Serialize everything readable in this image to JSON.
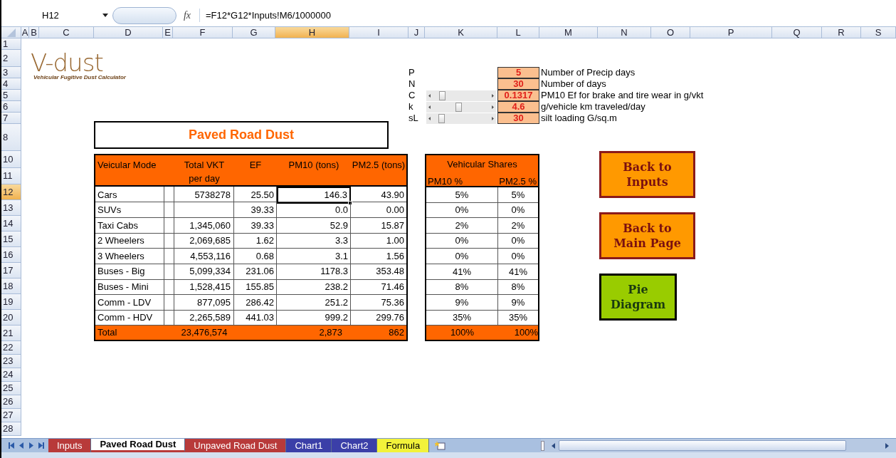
{
  "formula_bar": {
    "name_box": "H12",
    "function_button": "fx",
    "formula": "=F12*G12*Inputs!M6/1000000"
  },
  "columns": [
    {
      "label": "A",
      "selected": false
    },
    {
      "label": "B",
      "selected": false
    },
    {
      "label": "C",
      "selected": false
    },
    {
      "label": "D",
      "selected": false
    },
    {
      "label": "E",
      "selected": false
    },
    {
      "label": "F",
      "selected": false
    },
    {
      "label": "G",
      "selected": false
    },
    {
      "label": "H",
      "selected": true
    },
    {
      "label": "I",
      "selected": false
    },
    {
      "label": "J",
      "selected": false
    },
    {
      "label": "K",
      "selected": false
    },
    {
      "label": "L",
      "selected": false
    },
    {
      "label": "M",
      "selected": false
    },
    {
      "label": "N",
      "selected": false
    },
    {
      "label": "O",
      "selected": false
    },
    {
      "label": "P",
      "selected": false
    },
    {
      "label": "Q",
      "selected": false
    },
    {
      "label": "R",
      "selected": false
    },
    {
      "label": "S",
      "selected": false
    }
  ],
  "rows": [
    {
      "label": "1",
      "selected": false
    },
    {
      "label": "2",
      "selected": false
    },
    {
      "label": "3",
      "selected": false
    },
    {
      "label": "4",
      "selected": false
    },
    {
      "label": "5",
      "selected": false
    },
    {
      "label": "6",
      "selected": false
    },
    {
      "label": "7",
      "selected": false
    },
    {
      "label": "8",
      "selected": false
    },
    {
      "label": "10",
      "selected": false
    },
    {
      "label": "11",
      "selected": false
    },
    {
      "label": "12",
      "selected": true
    },
    {
      "label": "13",
      "selected": false
    },
    {
      "label": "14",
      "selected": false
    },
    {
      "label": "15",
      "selected": false
    },
    {
      "label": "16",
      "selected": false
    },
    {
      "label": "17",
      "selected": false
    },
    {
      "label": "18",
      "selected": false
    },
    {
      "label": "19",
      "selected": false
    },
    {
      "label": "20",
      "selected": false
    },
    {
      "label": "21",
      "selected": false
    },
    {
      "label": "22",
      "selected": false
    },
    {
      "label": "23",
      "selected": false
    },
    {
      "label": "24",
      "selected": false
    },
    {
      "label": "25",
      "selected": false
    },
    {
      "label": "26",
      "selected": false
    },
    {
      "label": "27",
      "selected": false
    },
    {
      "label": "28",
      "selected": false
    }
  ],
  "logo": {
    "title": "V-dust",
    "subtitle": "Vehicular Fugitive Dust Calculator"
  },
  "parameters": [
    {
      "symbol": "P",
      "kind": "fixed",
      "value": "5",
      "description": "Number of Precip days"
    },
    {
      "symbol": "N",
      "kind": "fixed",
      "value": "30",
      "description": "Number of days"
    },
    {
      "symbol": "C",
      "kind": "slider",
      "level": 0.12,
      "value": "0.1317",
      "description": "PM10 Ef for brake and tire wear in g/vkt"
    },
    {
      "symbol": "k",
      "kind": "slider",
      "level": 0.45,
      "value": "4.6",
      "description": "g/vehicle km traveled/day"
    },
    {
      "symbol": "sL",
      "kind": "slider",
      "level": 0.1,
      "value": "30",
      "description": "silt loading G/sq.m"
    }
  ],
  "title": "Paved Road Dust",
  "table": {
    "columns": [
      "Veicular Mode",
      "Total VKT per day",
      "EF",
      "PM10 (tons)",
      "PM2.5 (tons)"
    ],
    "rows": [
      {
        "mode": "Cars",
        "vkt": "5738278",
        "ef": "25.50",
        "pm10": "146.3",
        "pm25": "43.90",
        "pm10_selected": true
      },
      {
        "mode": "SUVs",
        "ef": "39.33",
        "pm10": "0.0",
        "pm25": "0.00",
        "pm10_selected": false
      },
      {
        "mode": "Taxi Cabs",
        "vkt": "1,345,060",
        "ef": "39.33",
        "pm10": "52.9",
        "pm25": "15.87",
        "pm10_selected": false
      },
      {
        "mode": "2 Wheelers",
        "vkt": "2,069,685",
        "ef": "1.62",
        "pm10": "3.3",
        "pm25": "1.00",
        "pm10_selected": false
      },
      {
        "mode": "3 Wheelers",
        "vkt": "4,553,116",
        "ef": "0.68",
        "pm10": "3.1",
        "pm25": "1.56",
        "pm10_selected": false
      },
      {
        "mode": "Buses - Big",
        "vkt": "5,099,334",
        "ef": "231.06",
        "pm10": "1178.3",
        "pm25": "353.48",
        "pm10_selected": false
      },
      {
        "mode": "Buses - Mini",
        "vkt": "1,528,415",
        "ef": "155.85",
        "pm10": "238.2",
        "pm25": "71.46",
        "pm10_selected": false
      },
      {
        "mode": "Comm - LDV",
        "vkt": "877,095",
        "ef": "286.42",
        "pm10": "251.2",
        "pm25": "75.36",
        "pm10_selected": false
      },
      {
        "mode": "Comm - HDV",
        "vkt": "2,265,589",
        "ef": "441.03",
        "pm10": "999.2",
        "pm25": "299.76",
        "pm10_selected": false
      }
    ],
    "total": {
      "mode": "Total",
      "vkt": "23,476,574",
      "pm10": "2,873",
      "pm25": "862"
    }
  },
  "shares": {
    "title": "Vehicular Shares",
    "columns": [
      "PM10 %",
      "PM2.5 %"
    ],
    "rows": [
      [
        "5%",
        "5%"
      ],
      [
        "0%",
        "0%"
      ],
      [
        "2%",
        "2%"
      ],
      [
        "0%",
        "0%"
      ],
      [
        "0%",
        "0%"
      ],
      [
        "41%",
        "41%"
      ],
      [
        "8%",
        "8%"
      ],
      [
        "9%",
        "9%"
      ],
      [
        "35%",
        "35%"
      ]
    ],
    "total": [
      "100%",
      "100%"
    ]
  },
  "buttons": [
    {
      "label": "Back to Inputs",
      "kind": "navigation",
      "color": "#ff9900"
    },
    {
      "label": "Back to Main Page",
      "kind": "navigation",
      "color": "#ff9900"
    },
    {
      "label": "Pie Diagram",
      "kind": "chart",
      "color": "#99cc00"
    }
  ],
  "sheet_tabs": [
    {
      "label": "Inputs",
      "selected": false,
      "color": "#b83a3a"
    },
    {
      "label": "Paved Road Dust",
      "selected": true,
      "color": "#b83a3a"
    },
    {
      "label": "Unpaved Road Dust",
      "selected": false,
      "color": "#b83a3a"
    },
    {
      "label": "Chart1",
      "selected": false,
      "color": "#3b3fa8"
    },
    {
      "label": "Chart2",
      "selected": false,
      "color": "#3b3fa8"
    },
    {
      "label": "Formula",
      "selected": false,
      "color": "#f2f23a"
    }
  ]
}
